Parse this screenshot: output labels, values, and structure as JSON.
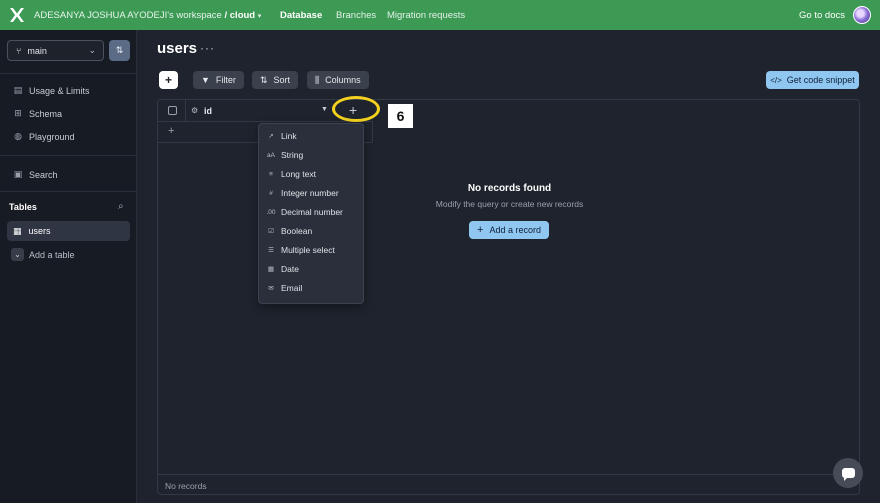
{
  "topbar": {
    "workspace_name": "ADESANYA JOSHUA AYODEJI's workspace",
    "separator": "/",
    "database_name": "cloud",
    "database_caret": "▾",
    "nav": [
      {
        "label": "Database",
        "active": true
      },
      {
        "label": "Branches",
        "active": false
      },
      {
        "label": "Migration requests",
        "active": false
      }
    ],
    "docs_link": "Go to docs"
  },
  "sidebar": {
    "branch": "main",
    "items": [
      {
        "label": "Usage & Limits",
        "icon": "chart-icon"
      },
      {
        "label": "Schema",
        "icon": "schema-icon"
      },
      {
        "label": "Playground",
        "icon": "playground-icon"
      },
      {
        "label": "Search",
        "icon": "search-doc-icon"
      }
    ],
    "tables_heading": "Tables",
    "tables": [
      {
        "label": "users",
        "active": true
      }
    ],
    "add_table_label": "Add a table"
  },
  "main": {
    "title": "users",
    "more_dots": "···",
    "toolbar": {
      "add_label": "+",
      "filter_label": "Filter",
      "sort_label": "Sort",
      "columns_label": "Columns",
      "code_snippet_label": "Get code snippet"
    },
    "grid": {
      "column_id_label": "id",
      "add_column_symbol": "+",
      "add_row_symbol": "+",
      "step_badge": "6",
      "empty_title": "No records found",
      "empty_subtitle": "Modify the query or create new records",
      "add_record_label": "Add a record",
      "footer_label": "No records"
    },
    "column_type_menu": [
      {
        "label": "Link",
        "icon": "link-icon",
        "glyph": "↗"
      },
      {
        "label": "String",
        "icon": "string-icon",
        "glyph": "aA"
      },
      {
        "label": "Long text",
        "icon": "long-text-icon",
        "glyph": "≡"
      },
      {
        "label": "Integer number",
        "icon": "hash-icon",
        "glyph": "#"
      },
      {
        "label": "Decimal number",
        "icon": "decimal-icon",
        "glyph": ".00"
      },
      {
        "label": "Boolean",
        "icon": "checkbox-icon",
        "glyph": "☑"
      },
      {
        "label": "Multiple select",
        "icon": "list-icon",
        "glyph": "☰"
      },
      {
        "label": "Date",
        "icon": "calendar-icon",
        "glyph": "▦"
      },
      {
        "label": "Email",
        "icon": "email-icon",
        "glyph": "✉"
      }
    ]
  },
  "colors": {
    "topbar": "#3c9a55",
    "accent": "#8fc7f0",
    "highlight_ring": "#f2d21e",
    "background": "#1e232d",
    "sidebar": "#171b23"
  }
}
